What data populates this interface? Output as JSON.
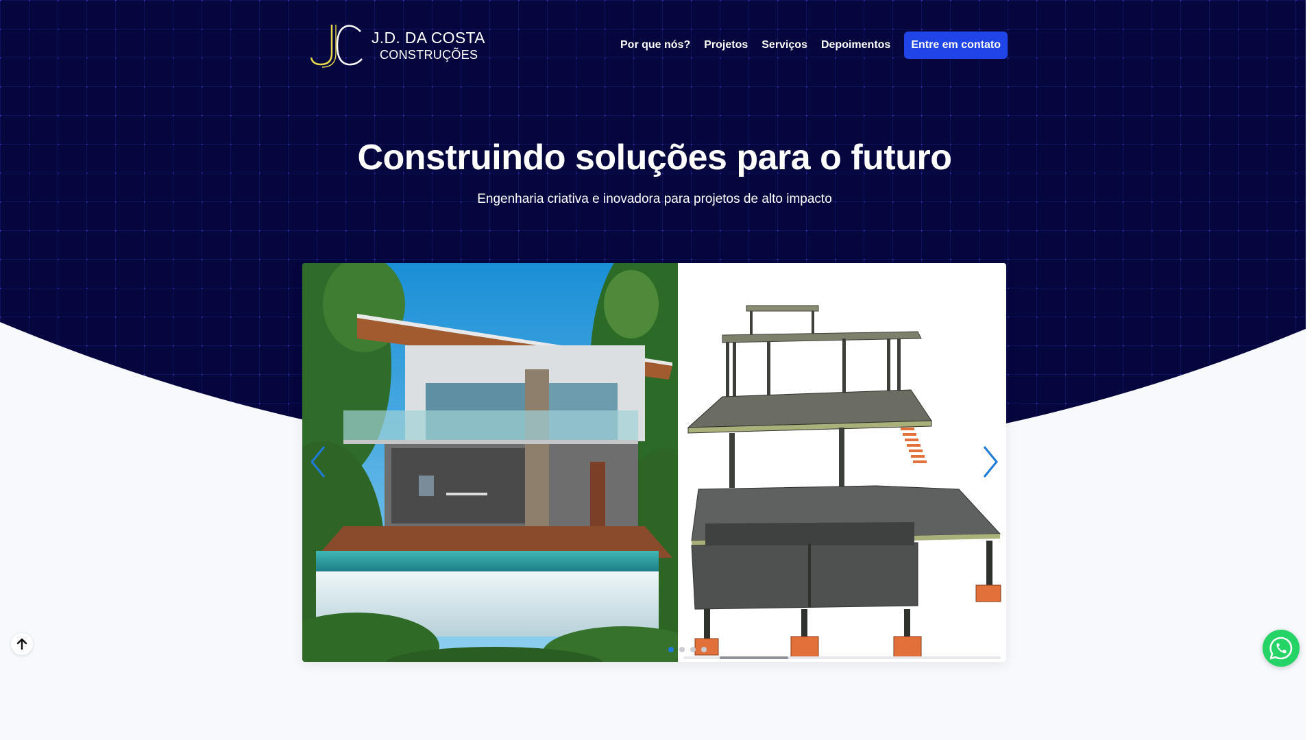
{
  "brand": {
    "name_line1": "J.D. DA COSTA",
    "name_line2": "CONSTRUÇÕES",
    "colors": {
      "navy": "#06063f",
      "accent_blue": "#1f44e8",
      "logo_gold": "#e8d84a",
      "whatsapp_green": "#25d366"
    }
  },
  "nav": {
    "links": [
      "Por que nós?",
      "Projetos",
      "Serviços",
      "Depoimentos"
    ],
    "cta_label": "Entre em contato"
  },
  "hero": {
    "title": "Construindo soluções para o futuro",
    "subtitle": "Engenharia criativa e inovadora para projetos de alto impacto"
  },
  "carousel": {
    "slides": [
      "modern-house-render-image",
      "structural-3d-model-image"
    ],
    "dots": 4,
    "active_dot": 1,
    "icons": {
      "prev": "chevron-left-icon",
      "next": "chevron-right-icon"
    }
  },
  "floating": {
    "back_to_top_icon": "arrow-up-icon",
    "whatsapp_icon": "whatsapp-icon"
  }
}
